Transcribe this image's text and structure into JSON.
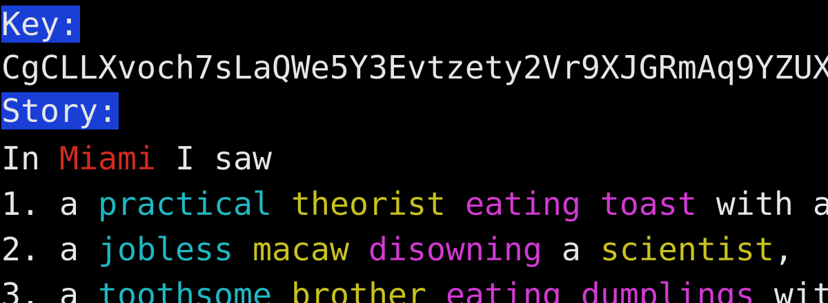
{
  "colors": {
    "background": "#000000",
    "default_text": "#e6e6e6",
    "highlight_bg": "#1a3fd6",
    "red": "#d42a1f",
    "cyan": "#1fb8c2",
    "yellow": "#c9c21e",
    "magenta": "#d23ad2"
  },
  "key_label": "Key:",
  "key_value": "CgCLLXvoch7sLaQWe5Y3Evtzety2Vr9XJGRmAq9YZUX",
  "story_label": "Story:",
  "intro": {
    "prefix": "In ",
    "city": "Miami",
    "suffix": " I saw"
  },
  "items": [
    {
      "number": "1.",
      "article": "a",
      "adjective": "practical",
      "noun": "theorist",
      "verb": "eating",
      "object": "toast",
      "tail": "with a"
    },
    {
      "number": "2.",
      "article": "a",
      "adjective": "jobless",
      "noun": "macaw",
      "verb": "disowning",
      "mid": "a",
      "object": "scientist",
      "tail": ","
    },
    {
      "number": "3.",
      "article": "a",
      "adjective": "toothsome",
      "noun": "brother",
      "verb": "eating",
      "object": "dumplings",
      "tail": "wit"
    }
  ]
}
